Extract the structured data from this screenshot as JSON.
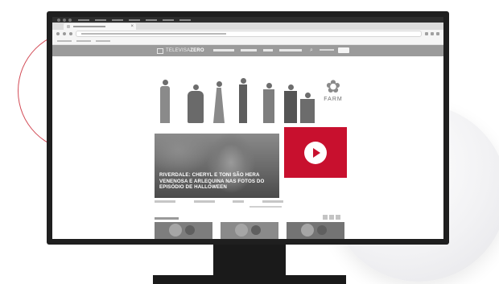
{
  "site": {
    "logo_prefix": "TELEVISA",
    "logo_suffix": "ZERO",
    "search_icon": "⌕"
  },
  "banner": {
    "brand": "FARM",
    "brand_icon": "flower-icon"
  },
  "hero": {
    "title": "RIVERDALE: CHERYL E TONI SÃO HERA VENENOSA E ARLEQUINA NAS FOTOS DO EPISÓDIO DE HALLOWEEN"
  },
  "video": {
    "icon": "play-icon",
    "accent": "#c8102e"
  },
  "colors": {
    "monitor": "#1f1f1f",
    "accent_red": "#c8102e",
    "decor_arc": "#d24a55"
  }
}
